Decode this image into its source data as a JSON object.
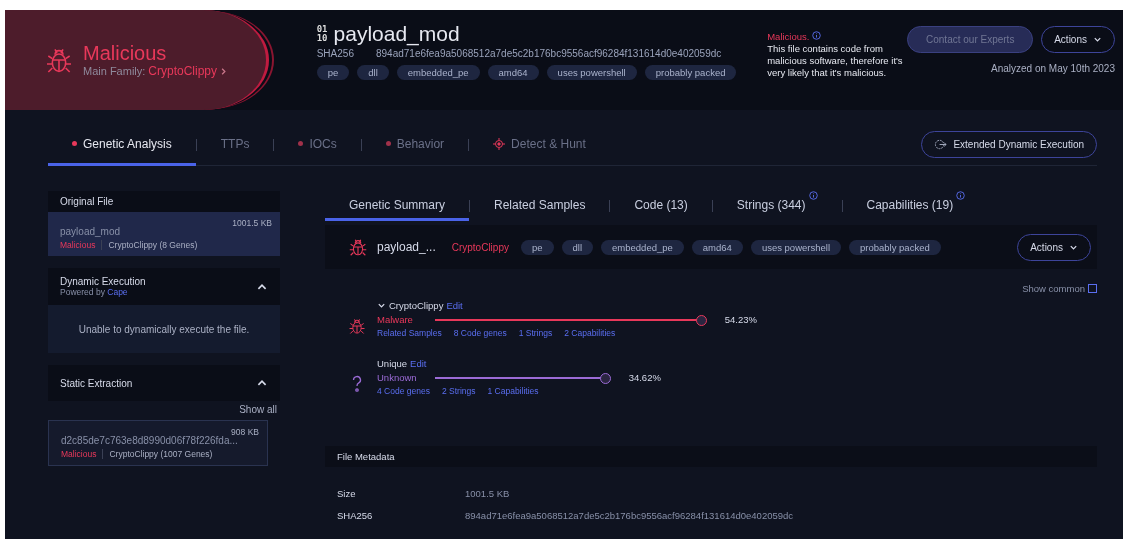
{
  "header": {
    "verdict": "Malicious",
    "family_label": "Main Family:",
    "family": "CryptoClippy",
    "binary_glyph": [
      "01",
      "10"
    ],
    "file_name": "payload_mod",
    "hash_label": "SHA256",
    "hash": "894ad71e6fea9a5068512a7de5c2b176bc9556acf96284f131614d0e402059dc",
    "tags": [
      "pe",
      "dll",
      "embedded_pe",
      "amd64",
      "uses powershell",
      "probably packed"
    ],
    "verdict_note_title": "Malicious.",
    "verdict_note": "This file contains code from malicious software, therefore it's very likely that it's malicious.",
    "contact_button": "Contact our Experts",
    "actions_button": "Actions",
    "analyzed": "Analyzed on May 10th 2023"
  },
  "tabs": [
    {
      "label": "Genetic Analysis",
      "kind": "dot",
      "selected": true
    },
    {
      "label": "TTPs",
      "kind": "plain",
      "selected": false
    },
    {
      "label": "IOCs",
      "kind": "dot",
      "selected": false
    },
    {
      "label": "Behavior",
      "kind": "dot",
      "selected": false
    },
    {
      "label": "Detect & Hunt",
      "kind": "target",
      "selected": false
    }
  ],
  "extended_button": "Extended Dynamic Execution",
  "sidebar": {
    "original": {
      "title": "Original File",
      "name": "payload_mod",
      "size": "1001.5 KB",
      "verdict": "Malicious",
      "family": "CryptoClippy (8 Genes)"
    },
    "dynamic": {
      "title": "Dynamic Execution",
      "powered_label": "Powered by",
      "powered_link": "Cape",
      "expanded": true,
      "message": "Unable to dynamically execute the file."
    },
    "static": {
      "title": "Static Extraction",
      "expanded": true,
      "show_all": "Show all",
      "item": {
        "name": "d2c85de7c763e8d8990d06f78f226fda...",
        "size": "908 KB",
        "verdict": "Malicious",
        "family": "CryptoClippy (1007 Genes)"
      }
    }
  },
  "subtabs": [
    {
      "label": "Genetic Summary",
      "info": false,
      "selected": true
    },
    {
      "label": "Related Samples",
      "info": false,
      "selected": false
    },
    {
      "label": "Code (13)",
      "info": false,
      "selected": false
    },
    {
      "label": "Strings (344)",
      "info": true,
      "selected": false
    },
    {
      "label": "Capabilities (19)",
      "info": true,
      "selected": false
    }
  ],
  "sample": {
    "name": "payload_...",
    "family": "CryptoClippy",
    "tags": [
      "pe",
      "dll",
      "embedded_pe",
      "amd64",
      "uses powershell",
      "probably packed"
    ],
    "actions_button": "Actions"
  },
  "show_common": {
    "label": "Show common",
    "checked": false
  },
  "genes": [
    {
      "kind": "family",
      "name": "CryptoClippy",
      "edit": "Edit",
      "category": "Malware",
      "level": 0.5423,
      "reading": "54.23%",
      "links": [
        "Related Samples",
        "8 Code genes",
        "1 Strings",
        "2 Capabilities"
      ]
    },
    {
      "kind": "unique",
      "name": "Unique",
      "edit": "Edit",
      "category": "Unknown",
      "level": 0.3462,
      "reading": "34.62%",
      "links": [
        "4 Code genes",
        "2 Strings",
        "1 Capabilities"
      ]
    }
  ],
  "metadata": {
    "title": "File Metadata",
    "rows": [
      {
        "label": "Size",
        "value": "1001.5 KB"
      },
      {
        "label": "SHA256",
        "value": "894ad71e6fea9a5068512a7de5c2b176bc9556acf96284f131614d0e402059dc"
      }
    ]
  }
}
